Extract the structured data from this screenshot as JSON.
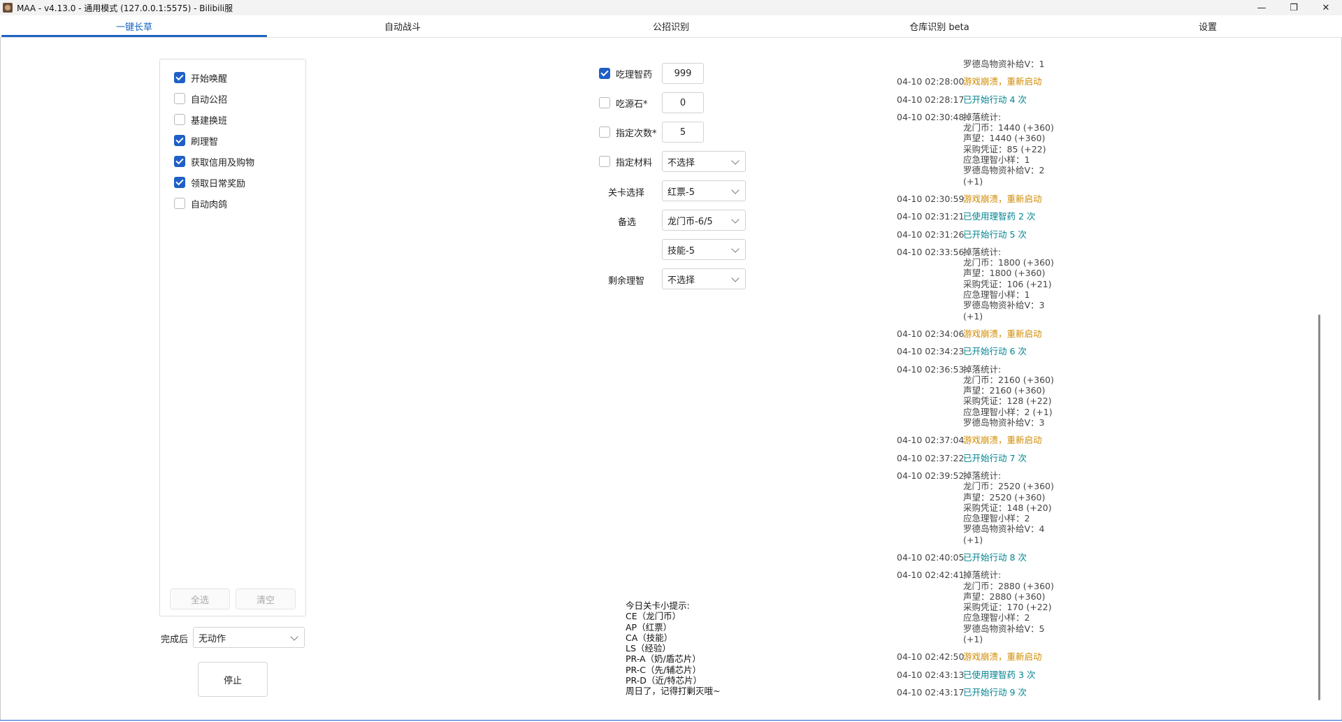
{
  "window": {
    "title": "MAA - v4.13.0 - 通用模式 (127.0.0.1:5575) - Bilibili服",
    "controls": {
      "minimize": "—",
      "restore": "❐",
      "close": "✕"
    }
  },
  "tabs": [
    {
      "label": "一键长草",
      "active": true
    },
    {
      "label": "自动战斗"
    },
    {
      "label": "公招识别"
    },
    {
      "label": "仓库识别 beta"
    },
    {
      "label": "设置"
    }
  ],
  "tasks": [
    {
      "label": "开始唤醒",
      "checked": true
    },
    {
      "label": "自动公招",
      "checked": false
    },
    {
      "label": "基建换班",
      "checked": false
    },
    {
      "label": "刷理智",
      "checked": true
    },
    {
      "label": "获取信用及购物",
      "checked": true
    },
    {
      "label": "领取日常奖励",
      "checked": true
    },
    {
      "label": "自动肉鸽",
      "checked": false
    }
  ],
  "task_buttons": {
    "select_all": "全选",
    "clear": "清空"
  },
  "after_complete": {
    "label": "完成后",
    "value": "无动作"
  },
  "stop_button": "停止",
  "fight": {
    "medicine": {
      "label": "吃理智药",
      "checked": true,
      "value": "999"
    },
    "stone": {
      "label": "吃源石*",
      "checked": false,
      "value": "0"
    },
    "times": {
      "label": "指定次数*",
      "checked": false,
      "value": "5"
    },
    "material": {
      "label": "指定材料",
      "checked": false,
      "value": "不选择"
    },
    "stage": {
      "label": "关卡选择",
      "value": "红票-5"
    },
    "alternate": {
      "label": "备选",
      "value1": "龙门币-6/5",
      "value2": "技能-5"
    },
    "remaining": {
      "label": "剩余理智",
      "value": "不选择"
    }
  },
  "tips": [
    "今日关卡小提示:",
    "CE（龙门币）",
    "AP（红票）",
    "CA（技能）",
    "LS（经验）",
    "PR-A（奶/盾芯片）",
    "PR-C（先/辅芯片）",
    "PR-D（近/特芯片）",
    "周日了，记得打剿灭哦~"
  ],
  "log_head": "罗德岛物资补给V：1",
  "log": [
    {
      "time": "04-10  02:28:00",
      "type": "warn",
      "lines": [
        "游戏崩溃，重新启动"
      ]
    },
    {
      "time": "04-10  02:28:17",
      "type": "info",
      "lines": [
        "已开始行动 4 次"
      ]
    },
    {
      "time": "04-10  02:30:48",
      "type": "normal",
      "lines": [
        "掉落统计:",
        "龙门币：1440 (+360)",
        "声望：1440 (+360)",
        "采购凭证：85 (+22)",
        "应急理智小样：1",
        "罗德岛物资补给V：2",
        "(+1)"
      ]
    },
    {
      "time": "04-10  02:30:59",
      "type": "warn",
      "lines": [
        "游戏崩溃，重新启动"
      ]
    },
    {
      "time": "04-10  02:31:21",
      "type": "info",
      "lines": [
        "已使用理智药 2 次"
      ]
    },
    {
      "time": "04-10  02:31:26",
      "type": "info",
      "lines": [
        "已开始行动 5 次"
      ]
    },
    {
      "time": "04-10  02:33:56",
      "type": "normal",
      "lines": [
        "掉落统计:",
        "龙门币：1800 (+360)",
        "声望：1800 (+360)",
        "采购凭证：106 (+21)",
        "应急理智小样：1",
        "罗德岛物资补给V：3",
        "(+1)"
      ]
    },
    {
      "time": "04-10  02:34:06",
      "type": "warn",
      "lines": [
        "游戏崩溃，重新启动"
      ]
    },
    {
      "time": "04-10  02:34:23",
      "type": "info",
      "lines": [
        "已开始行动 6 次"
      ]
    },
    {
      "time": "04-10  02:36:53",
      "type": "normal",
      "lines": [
        "掉落统计:",
        "龙门币：2160 (+360)",
        "声望：2160 (+360)",
        "采购凭证：128 (+22)",
        "应急理智小样：2 (+1)",
        "罗德岛物资补给V：3"
      ]
    },
    {
      "time": "04-10  02:37:04",
      "type": "warn",
      "lines": [
        "游戏崩溃，重新启动"
      ]
    },
    {
      "time": "04-10  02:37:22",
      "type": "info",
      "lines": [
        "已开始行动 7 次"
      ]
    },
    {
      "time": "04-10  02:39:52",
      "type": "normal",
      "lines": [
        "掉落统计:",
        "龙门币：2520 (+360)",
        "声望：2520 (+360)",
        "采购凭证：148 (+20)",
        "应急理智小样：2",
        "罗德岛物资补给V：4",
        "(+1)"
      ]
    },
    {
      "time": "04-10  02:40:05",
      "type": "info",
      "lines": [
        "已开始行动 8 次"
      ]
    },
    {
      "time": "04-10  02:42:41",
      "type": "normal",
      "lines": [
        "掉落统计:",
        "龙门币：2880 (+360)",
        "声望：2880 (+360)",
        "采购凭证：170 (+22)",
        "应急理智小样：2",
        "罗德岛物资补给V：5",
        "(+1)"
      ]
    },
    {
      "time": "04-10  02:42:50",
      "type": "warn",
      "lines": [
        "游戏崩溃，重新启动"
      ]
    },
    {
      "time": "04-10  02:43:13",
      "type": "info",
      "lines": [
        "已使用理智药 3 次"
      ]
    },
    {
      "time": "04-10  02:43:17",
      "type": "info",
      "lines": [
        "已开始行动 9 次"
      ]
    }
  ]
}
